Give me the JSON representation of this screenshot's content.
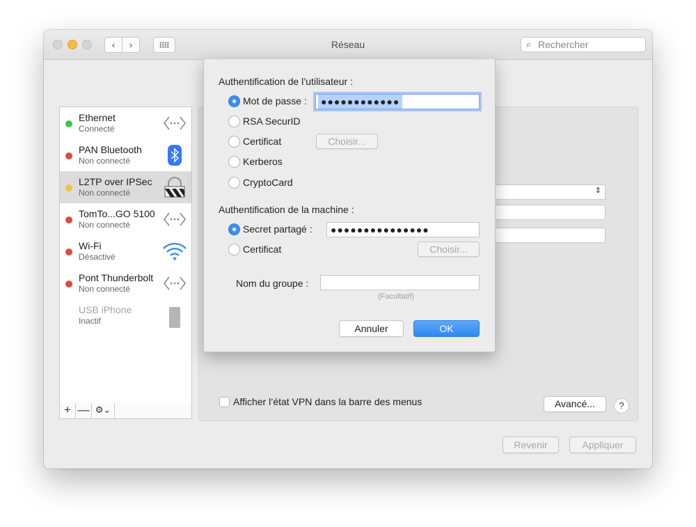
{
  "window": {
    "title": "Réseau",
    "search_placeholder": "Rechercher"
  },
  "colors": {
    "status_green": "#3cc74a",
    "status_red": "#e2483f",
    "status_yellow": "#f6c33d",
    "accent": "#3b8ff0"
  },
  "sidebar": {
    "services": [
      {
        "name": "Ethernet",
        "status": "Connecté",
        "icon": "ethernet-icon"
      },
      {
        "name": "PAN Bluetooth",
        "status": "Non connecté",
        "icon": "bluetooth-icon"
      },
      {
        "name": "L2TP over IPSec",
        "status": "Non connecté",
        "icon": "vpn-lock-icon"
      },
      {
        "name": "TomTo...GO 5100",
        "status": "Non connecté",
        "icon": "ethernet-icon"
      },
      {
        "name": "Wi-Fi",
        "status": "Désactivé",
        "icon": "wifi-icon"
      },
      {
        "name": "Pont Thunderbolt",
        "status": "Non connecté",
        "icon": "ethernet-icon"
      },
      {
        "name": "USB iPhone",
        "status": "Inactif",
        "icon": "iphone-icon"
      }
    ],
    "tools": {
      "add": "+",
      "remove": "—"
    }
  },
  "panel": {
    "show_vpn_status_label": "Afficher l’état VPN dans la barre des menus",
    "advanced_label": "Avancé...",
    "help_label": "?",
    "revert_label": "Revenir",
    "apply_label": "Appliquer"
  },
  "dialog": {
    "user_auth_title": "Authentification de l’utilisateur :",
    "user_options": {
      "password": "Mot de passe :",
      "rsa": "RSA SecurID",
      "certificate": "Certificat",
      "kerberos": "Kerberos",
      "cryptocard": "CryptoCard"
    },
    "password_value": "●●●●●●●●●●●●",
    "choose_label": "Choisir...",
    "machine_auth_title": "Authentification de la machine :",
    "machine_options": {
      "shared_secret": "Secret partagé :",
      "certificate": "Certificat"
    },
    "shared_secret_value": "●●●●●●●●●●●●●●●",
    "machine_choose_label": "Choisir...",
    "group_name_label": "Nom du groupe :",
    "group_name_value": "",
    "optional_hint": "(Facultatif)",
    "cancel_label": "Annuler",
    "ok_label": "OK"
  }
}
